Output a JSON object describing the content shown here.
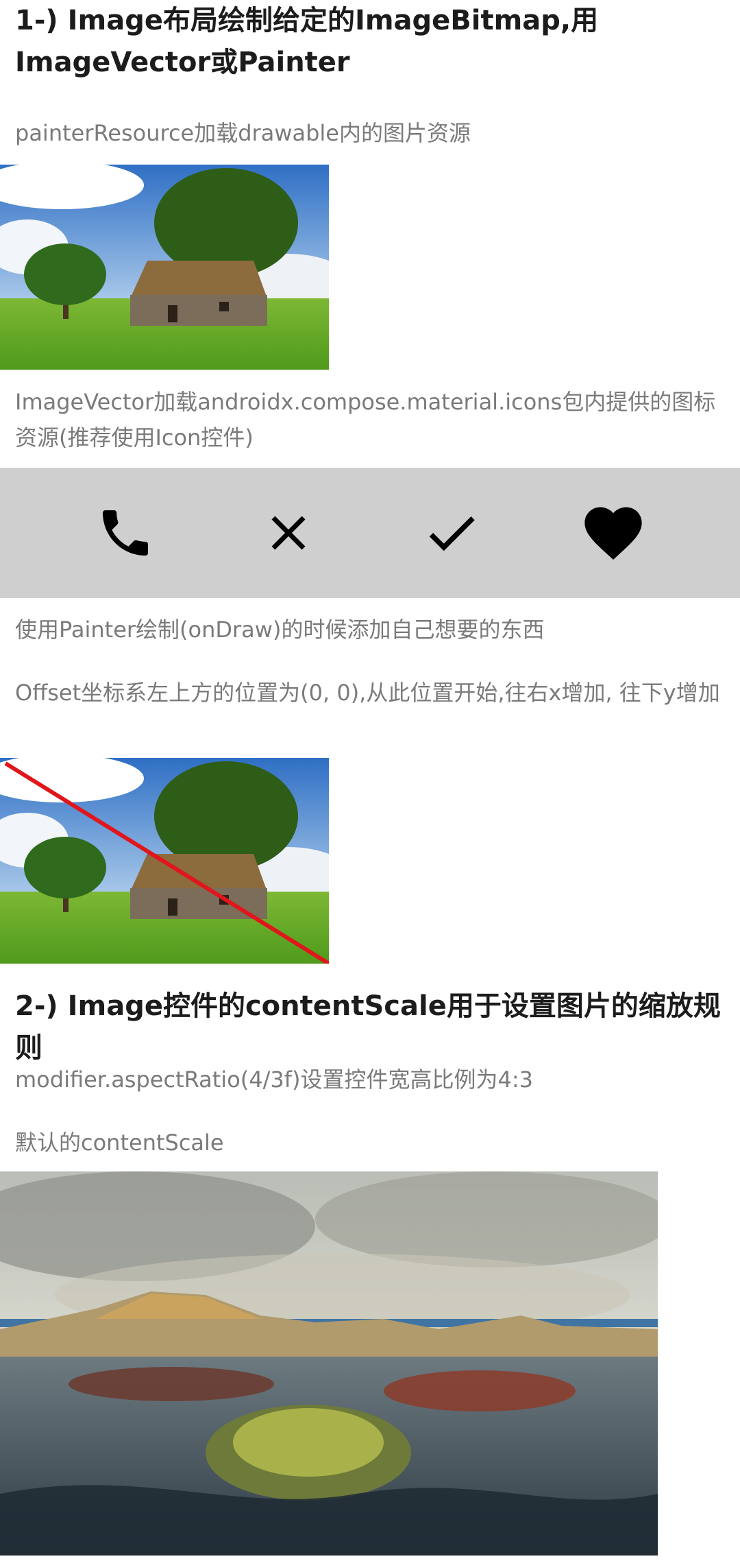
{
  "section1": {
    "number": "1-)",
    "title": "Image布局绘制给定的ImageBitmap,用ImageVector或Painter",
    "painter_desc": "painterResource加载drawable内的图片资源",
    "vector_desc": "ImageVector加载androidx.compose.material.icons包内提供的图标资源(推荐使用Icon控件)",
    "icons": [
      "phone-icon",
      "close-icon",
      "check-icon",
      "heart-icon"
    ],
    "icon_row_bg": "#cfcfcf",
    "ondraw_desc": "使用Painter绘制(onDraw)的时候添加自己想要的东西",
    "offset_desc": "Offset坐标系左上方的位置为(0, 0),从此位置开始,往右x增加, 往下y增加",
    "line_color": "#e0161c"
  },
  "section2": {
    "number": "2-)",
    "title": "Image控件的contentScale用于设置图片的缩放规则",
    "aspect_desc": "modifier.aspectRatio(4/3f)设置控件宽高比例为4:3",
    "default_scale_desc": "默认的contentScale"
  }
}
